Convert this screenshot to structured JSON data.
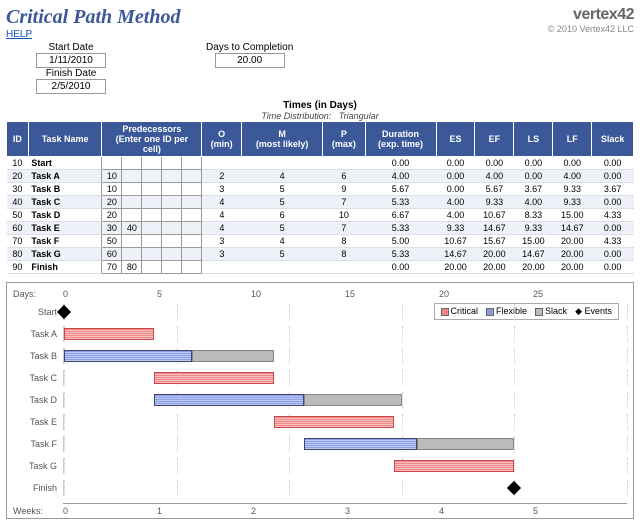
{
  "title": "Critical Path Method",
  "help_link": "HELP",
  "brand": "vertex42",
  "copyright": "© 2010 Vertex42 LLC",
  "meta": {
    "start_label": "Start Date",
    "start_val": "1/11/2010",
    "finish_label": "Finish Date",
    "finish_val": "2/5/2010",
    "days_label": "Days to Completion",
    "days_val": "20.00"
  },
  "times_header": "Times (in Days)",
  "times_sub_left": "Time Distribution:",
  "times_sub_right": "Triangular",
  "columns": {
    "id": "ID",
    "name": "Task Name",
    "pred": "Predecessors",
    "pred_sub": "(Enter one ID per cell)",
    "o": "O",
    "o_sub": "(min)",
    "m": "M",
    "m_sub": "(most likely)",
    "p": "P",
    "p_sub": "(max)",
    "dur": "Duration",
    "dur_sub": "(exp. time)",
    "es": "ES",
    "ef": "EF",
    "ls": "LS",
    "lf": "LF",
    "slack": "Slack"
  },
  "rows": [
    {
      "id": "10",
      "name": "Start",
      "pred": [
        "",
        "",
        "",
        "",
        ""
      ],
      "o": "",
      "m": "",
      "p": "",
      "dur": "0.00",
      "es": "0.00",
      "ef": "0.00",
      "ls": "0.00",
      "lf": "0.00",
      "slack": "0.00"
    },
    {
      "id": "20",
      "name": "Task A",
      "pred": [
        "10",
        "",
        "",
        "",
        ""
      ],
      "o": "2",
      "m": "4",
      "p": "6",
      "dur": "4.00",
      "es": "0.00",
      "ef": "4.00",
      "ls": "0.00",
      "lf": "4.00",
      "slack": "0.00"
    },
    {
      "id": "30",
      "name": "Task B",
      "pred": [
        "10",
        "",
        "",
        "",
        ""
      ],
      "o": "3",
      "m": "5",
      "p": "9",
      "dur": "5.67",
      "es": "0.00",
      "ef": "5.67",
      "ls": "3.67",
      "lf": "9.33",
      "slack": "3.67"
    },
    {
      "id": "40",
      "name": "Task C",
      "pred": [
        "20",
        "",
        "",
        "",
        ""
      ],
      "o": "4",
      "m": "5",
      "p": "7",
      "dur": "5.33",
      "es": "4.00",
      "ef": "9.33",
      "ls": "4.00",
      "lf": "9.33",
      "slack": "0.00"
    },
    {
      "id": "50",
      "name": "Task D",
      "pred": [
        "20",
        "",
        "",
        "",
        ""
      ],
      "o": "4",
      "m": "6",
      "p": "10",
      "dur": "6.67",
      "es": "4.00",
      "ef": "10.67",
      "ls": "8.33",
      "lf": "15.00",
      "slack": "4.33"
    },
    {
      "id": "60",
      "name": "Task E",
      "pred": [
        "30",
        "40",
        "",
        "",
        ""
      ],
      "o": "4",
      "m": "5",
      "p": "7",
      "dur": "5.33",
      "es": "9.33",
      "ef": "14.67",
      "ls": "9.33",
      "lf": "14.67",
      "slack": "0.00"
    },
    {
      "id": "70",
      "name": "Task F",
      "pred": [
        "50",
        "",
        "",
        "",
        ""
      ],
      "o": "3",
      "m": "4",
      "p": "8",
      "dur": "5.00",
      "es": "10.67",
      "ef": "15.67",
      "ls": "15.00",
      "lf": "20.00",
      "slack": "4.33"
    },
    {
      "id": "80",
      "name": "Task G",
      "pred": [
        "60",
        "",
        "",
        "",
        ""
      ],
      "o": "3",
      "m": "5",
      "p": "8",
      "dur": "5.33",
      "es": "14.67",
      "ef": "20.00",
      "ls": "14.67",
      "lf": "20.00",
      "slack": "0.00"
    },
    {
      "id": "90",
      "name": "Finish",
      "pred": [
        "70",
        "80",
        "",
        "",
        ""
      ],
      "o": "",
      "m": "",
      "p": "",
      "dur": "0.00",
      "es": "20.00",
      "ef": "20.00",
      "ls": "20.00",
      "lf": "20.00",
      "slack": "0.00"
    }
  ],
  "chart_data": {
    "type": "gantt",
    "x_axis_top": {
      "label": "Days:",
      "ticks": [
        "0",
        "5",
        "10",
        "15",
        "20",
        "25"
      ]
    },
    "x_axis_bottom": {
      "label": "Weeks:",
      "ticks": [
        "0",
        "1",
        "2",
        "3",
        "4",
        "5"
      ]
    },
    "legend": [
      {
        "name": "Critical",
        "color": "#e88888"
      },
      {
        "name": "Flexible",
        "color": "#8899dd"
      },
      {
        "name": "Slack",
        "color": "#bbbbbb"
      },
      {
        "name": "Events",
        "color": "#000000",
        "marker": "diamond"
      }
    ],
    "xlim": [
      0,
      25
    ],
    "tasks": [
      {
        "label": "Start",
        "event_at": 0
      },
      {
        "label": "Task A",
        "bars": [
          {
            "type": "critical",
            "from": 0,
            "to": 4
          }
        ]
      },
      {
        "label": "Task B",
        "bars": [
          {
            "type": "flexible",
            "from": 0,
            "to": 5.67
          },
          {
            "type": "slack",
            "from": 5.67,
            "to": 9.33
          }
        ]
      },
      {
        "label": "Task C",
        "bars": [
          {
            "type": "critical",
            "from": 4,
            "to": 9.33
          }
        ]
      },
      {
        "label": "Task D",
        "bars": [
          {
            "type": "flexible",
            "from": 4,
            "to": 10.67
          },
          {
            "type": "slack",
            "from": 10.67,
            "to": 15
          }
        ]
      },
      {
        "label": "Task E",
        "bars": [
          {
            "type": "critical",
            "from": 9.33,
            "to": 14.67
          }
        ]
      },
      {
        "label": "Task F",
        "bars": [
          {
            "type": "flexible",
            "from": 10.67,
            "to": 15.67
          },
          {
            "type": "slack",
            "from": 15.67,
            "to": 20
          }
        ]
      },
      {
        "label": "Task G",
        "bars": [
          {
            "type": "critical",
            "from": 14.67,
            "to": 20
          }
        ]
      },
      {
        "label": "Finish",
        "event_at": 20
      }
    ]
  }
}
